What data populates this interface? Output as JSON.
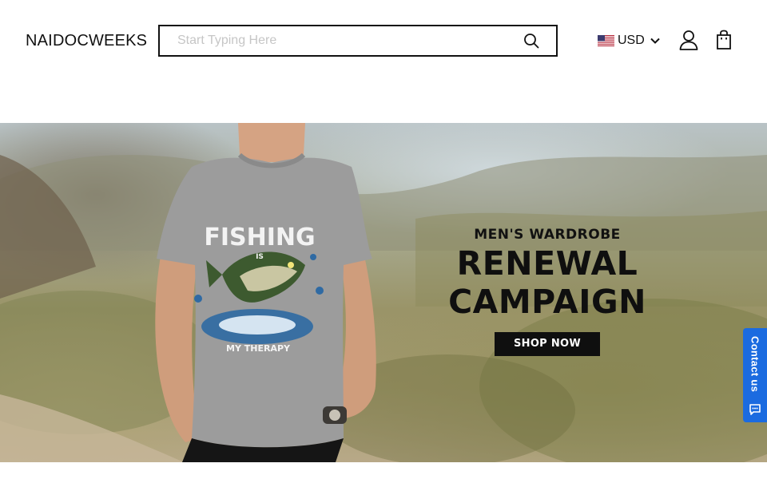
{
  "header": {
    "logo": "NAIDOCWEEKS",
    "search_placeholder": "Start Typing Here",
    "currency": "USD"
  },
  "hero": {
    "kicker": "MEN'S WARDROBE",
    "headline_line1": "RENEWAL",
    "headline_line2": "CAMPAIGN",
    "cta": "SHOP NOW",
    "shirt_text_top": "FISHING",
    "shirt_text_is": "IS",
    "shirt_text_bottom": "MY THERAPY"
  },
  "contact": {
    "label": "Contact us",
    "color": "#1b6be0"
  },
  "icons": [
    "search-icon",
    "us-flag-icon",
    "chevron-down-icon",
    "account-icon",
    "cart-icon",
    "chat-icon"
  ]
}
